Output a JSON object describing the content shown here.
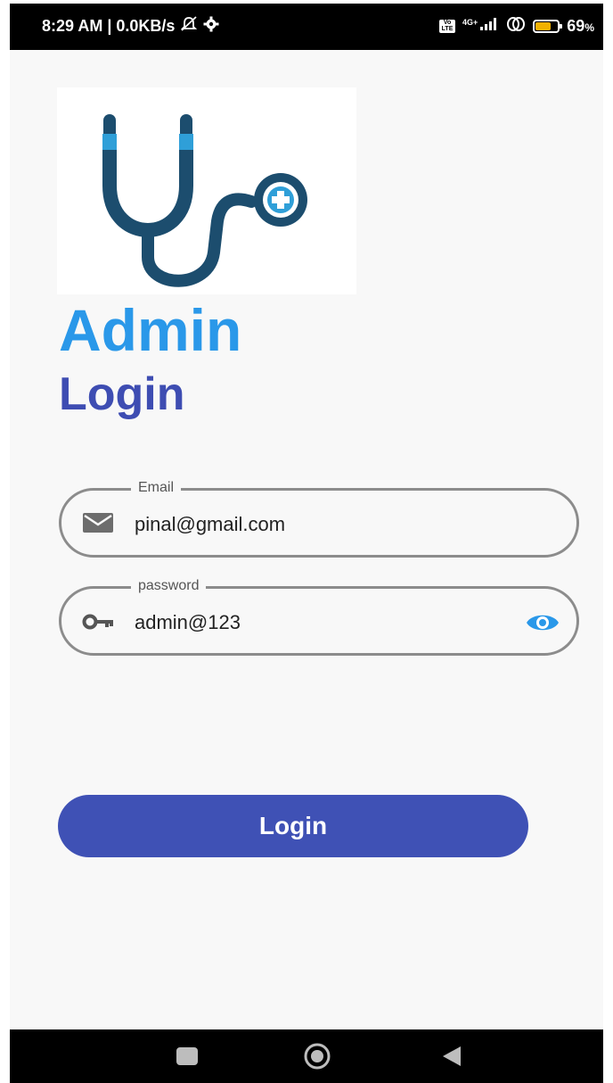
{
  "status_bar": {
    "time_speed": "8:29 AM | 0.0KB/s",
    "volte": "Vo LTE",
    "network": "4G+",
    "battery_percent": "69",
    "battery_unit": "%",
    "battery_level": 0.69
  },
  "header": {
    "title_line1": "Admin",
    "title_line2": "Login"
  },
  "form": {
    "email_label": "Email",
    "email_value": "pinal@gmail.com",
    "password_label": "password",
    "password_value": "admin@123"
  },
  "actions": {
    "login_label": "Login"
  },
  "icons": {
    "logo": "stethoscope-logo",
    "email": "mail-icon",
    "password": "key-icon",
    "visibility": "eye-icon"
  },
  "colors": {
    "title_admin": "#2a98e9",
    "title_login": "#3e4db2",
    "button": "#3f51b5",
    "eye_icon": "#2a98e9"
  }
}
